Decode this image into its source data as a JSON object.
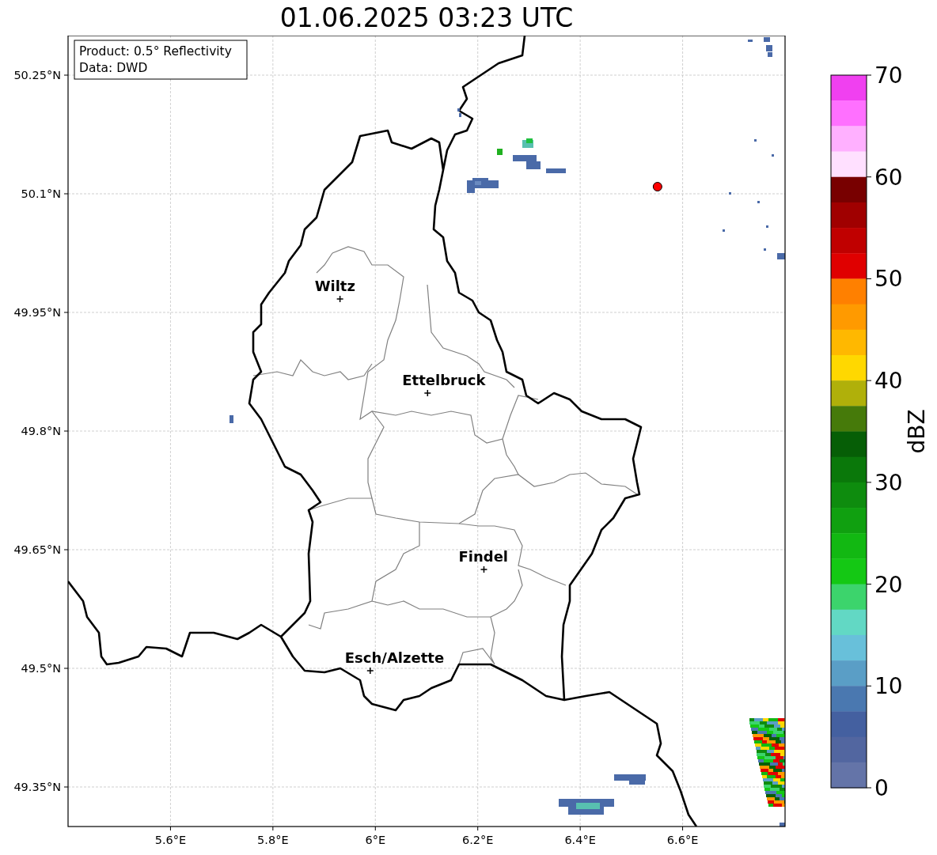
{
  "map": {
    "title": "01.06.2025 03:23 UTC",
    "info_box": {
      "lines": [
        "Product: 0.5° Reflectivity",
        "Data: DWD"
      ]
    },
    "y_tick_labels": [
      "50.25°N",
      "50.1°N",
      "49.95°N",
      "49.8°N",
      "49.65°N",
      "49.5°N",
      "49.35°N"
    ],
    "x_tick_labels": [
      "5.6°E",
      "5.8°E",
      "6°E",
      "6.2°E",
      "6.4°E",
      "6.6°E"
    ],
    "cities": [
      {
        "label": "Wiltz"
      },
      {
        "label": "Ettelbruck"
      },
      {
        "label": "Findel"
      },
      {
        "label": "Esch/Alzette"
      }
    ]
  },
  "colorbar": {
    "label": "dBZ",
    "ticks": [
      "70",
      "60",
      "50",
      "40",
      "30",
      "20",
      "10",
      "0"
    ],
    "segments": [
      {
        "color": "#f040f0"
      },
      {
        "color": "#ff70ff"
      },
      {
        "color": "#ffb0ff"
      },
      {
        "color": "#ffe0ff"
      },
      {
        "color": "#780000"
      },
      {
        "color": "#a00000"
      },
      {
        "color": "#c00000"
      },
      {
        "color": "#e00000"
      },
      {
        "color": "#ff8000"
      },
      {
        "color": "#ff9a00"
      },
      {
        "color": "#ffb800"
      },
      {
        "color": "#ffd800"
      },
      {
        "color": "#b0b00a"
      },
      {
        "color": "#467a0a"
      },
      {
        "color": "#065e06"
      },
      {
        "color": "#0a780a"
      },
      {
        "color": "#0e8c0e"
      },
      {
        "color": "#10a010"
      },
      {
        "color": "#12b812"
      },
      {
        "color": "#14c814"
      },
      {
        "color": "#3cd46c"
      },
      {
        "color": "#62d8c4"
      },
      {
        "color": "#68c0da"
      },
      {
        "color": "#5a9ec6"
      },
      {
        "color": "#4a78b0"
      },
      {
        "color": "#4460a0"
      },
      {
        "color": "#5266a0"
      },
      {
        "color": "#6474a8"
      }
    ]
  }
}
